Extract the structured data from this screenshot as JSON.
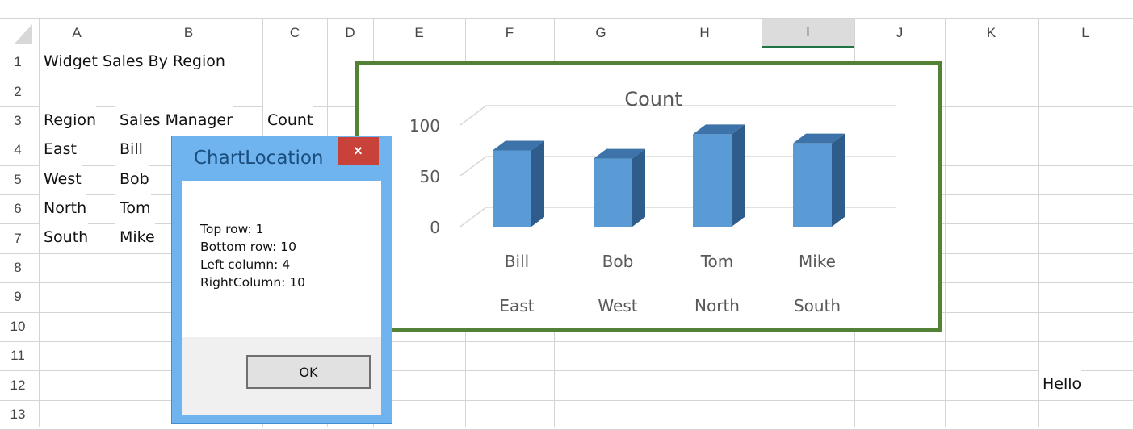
{
  "columns": [
    "A",
    "B",
    "C",
    "D",
    "E",
    "F",
    "G",
    "H",
    "I",
    "J",
    "K",
    "L"
  ],
  "rows": [
    "1",
    "2",
    "3",
    "4",
    "5",
    "6",
    "7",
    "8",
    "9",
    "10",
    "11",
    "12",
    "13"
  ],
  "cells": {
    "A1": "Widget Sales By Region",
    "A3": "Region",
    "B3": "Sales Manager",
    "C3": "Count",
    "A4": "East",
    "B4": "Bill",
    "A5": "West",
    "B5": "Bob",
    "A6": "North",
    "B6": "Tom",
    "A7": "South",
    "B7": "Mike",
    "L12": "Hello"
  },
  "selected_column": "I",
  "chart_data": {
    "type": "bar",
    "title": "Count",
    "categories": [
      [
        "Bill",
        "East"
      ],
      [
        "Bob",
        "West"
      ],
      [
        "Tom",
        "North"
      ],
      [
        "Mike",
        "South"
      ]
    ],
    "series": [
      {
        "values": [
          75,
          67,
          91,
          82
        ]
      }
    ],
    "ylim": [
      0,
      100
    ],
    "yticks": [
      0,
      50,
      100
    ],
    "three_d": true,
    "grid": true,
    "bar_color": "#5b9bd5",
    "border_color": "#538135"
  },
  "dialog": {
    "title": "ChartLocation",
    "close_icon": "×",
    "lines": [
      "Top row: 1",
      "Bottom row: 10",
      "Left column: 4",
      "RightColumn: 10"
    ],
    "ok_label": "OK"
  }
}
